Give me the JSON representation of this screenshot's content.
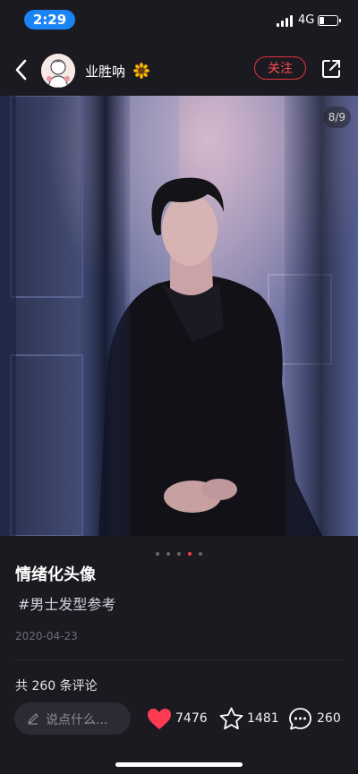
{
  "status_bar": {
    "time": "2:29",
    "network": "4G"
  },
  "header": {
    "username": "业胜呐",
    "follow_label": "关注"
  },
  "photo": {
    "counter": "8/9",
    "current_page": 8,
    "total_pages": 9
  },
  "post": {
    "title": "情绪化头像",
    "tag": "#男士发型参考",
    "date": "2020-04-23",
    "comments_summary": "共 260 条评论"
  },
  "bottom_bar": {
    "comment_placeholder": "说点什么...",
    "likes": "7476",
    "favorites": "1481",
    "comments": "260"
  },
  "colors": {
    "accent": "#ff3b52",
    "background": "#1b1a21",
    "status_pill": "#1a84f2"
  }
}
